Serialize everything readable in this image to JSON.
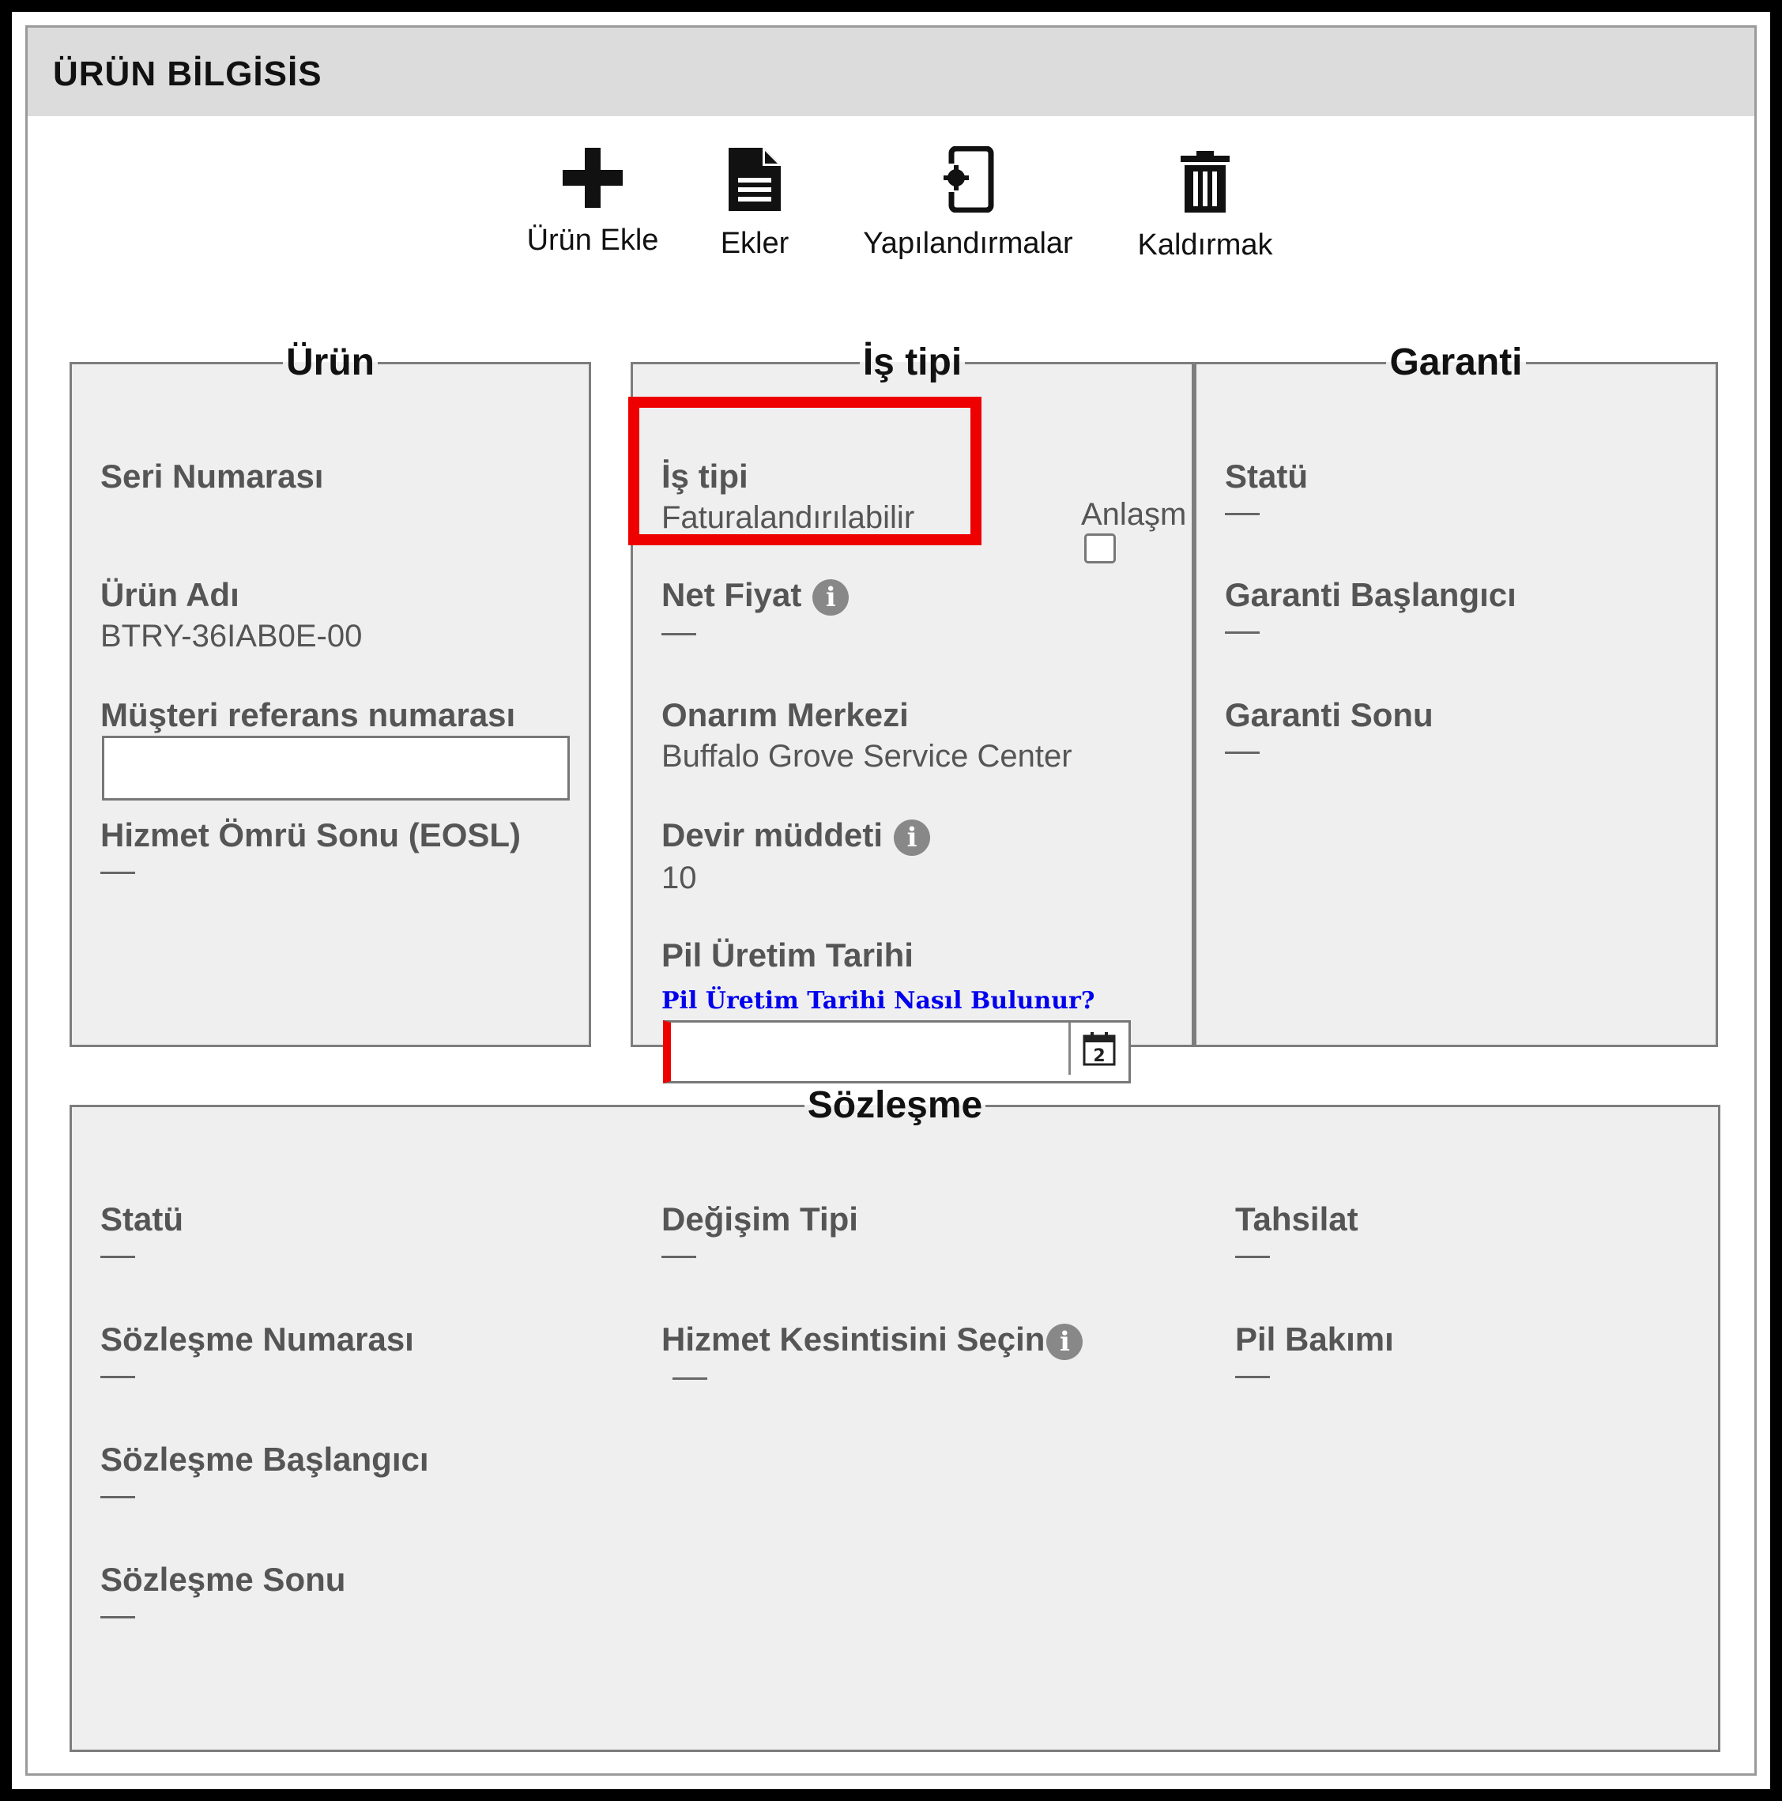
{
  "header": {
    "title": "ÜRÜN BİLGİSİS"
  },
  "toolbar": {
    "add_product": "Ürün Ekle",
    "attachments": "Ekler",
    "configurations": "Yapılandırmalar",
    "remove": "Kaldırmak"
  },
  "urun": {
    "legend": "Ürün",
    "serial_label": "Seri Numarası",
    "product_name_label": "Ürün Adı",
    "product_name_value": "BTRY-36IAB0E-00",
    "customer_ref_label": "Müşteri referans numarası",
    "customer_ref_value": "",
    "eosl_label": "Hizmet Ömrü Sonu (EOSL)"
  },
  "is_tipi": {
    "legend": "İş tipi",
    "type_label": "İş tipi",
    "type_value": "Faturalandırılabilir",
    "agreement_label": "Anlaşm",
    "net_price_label": "Net Fiyat",
    "repair_center_label": "Onarım Merkezi",
    "repair_center_value": "Buffalo Grove Service Center",
    "turnover_label": "Devir müddeti",
    "turnover_value": "10",
    "battery_date_label": "Pil Üretim Tarihi",
    "battery_date_link": "Pil Üretim Tarihi Nasıl Bulunur?",
    "battery_date_value": ""
  },
  "garanti": {
    "legend": "Garanti",
    "status_label": "Statü",
    "start_label": "Garanti Başlangıcı",
    "end_label": "Garanti Sonu"
  },
  "sozlesme": {
    "legend": "Sözleşme",
    "status_label": "Statü",
    "number_label": "Sözleşme Numarası",
    "start_label": "Sözleşme Başlangıcı",
    "end_label": "Sözleşme Sonu",
    "exchange_type_label": "Değişim Tipi",
    "service_cut_label": "Hizmet Kesintisini Seçin",
    "collection_label": "Tahsilat",
    "battery_maintenance_label": "Pil Bakımı"
  },
  "icons": {
    "add": "plus-icon",
    "attachments": "document-icon",
    "configurations": "device-gear-icon",
    "remove": "trash-icon",
    "info": "info-icon",
    "calendar": "calendar-icon"
  }
}
